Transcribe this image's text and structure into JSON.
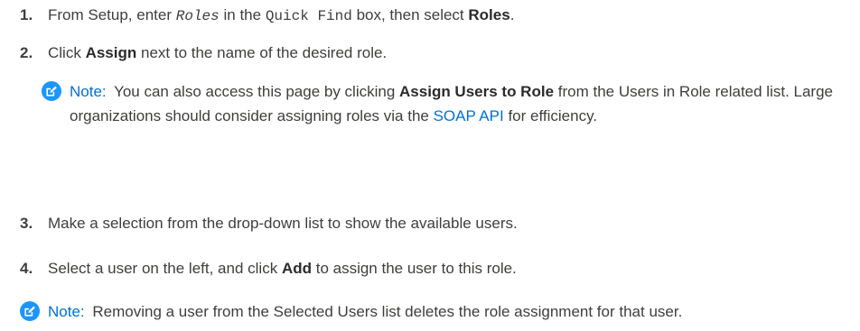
{
  "steps": [
    {
      "number": "1.",
      "pre": "From Setup, enter",
      "code1": "Roles",
      "mid": "in the",
      "code2": "Quick Find",
      "post": "box, then select",
      "bold": "Roles",
      "end": "."
    },
    {
      "number": "2.",
      "pre": "Click",
      "bold": "Assign",
      "post": "next to the name of the desired role."
    },
    {
      "number": "3.",
      "text": "Make a selection from the drop-down list to show the available users."
    },
    {
      "number": "4.",
      "pre": "Select a user on the left, and click",
      "bold": "Add",
      "post": "to assign the user to this role."
    }
  ],
  "note1": {
    "label": "Note:",
    "pre": "You can also access this page by clicking",
    "bold": "Assign Users to Role",
    "mid": "from the Users in Role related list. Large organizations should consider assigning roles via the",
    "link": "SOAP API",
    "post": "for efficiency."
  },
  "note2": {
    "label": "Note:",
    "text": "Removing a user from the Selected Users list deletes the role assignment for that user."
  },
  "colors": {
    "text": "#3e3e3c",
    "accent": "#0070d2",
    "icon": "#1b96ff"
  },
  "icons": {
    "note": "edit-note-icon"
  }
}
